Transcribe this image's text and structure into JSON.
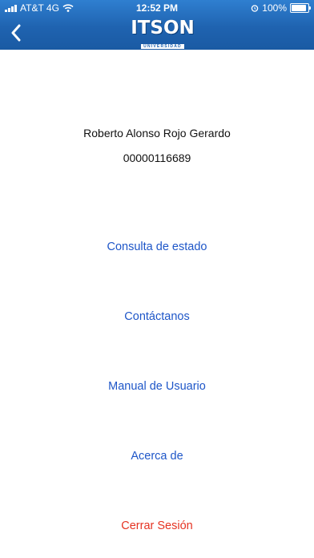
{
  "status_bar": {
    "carrier": "AT&T 4G",
    "time": "12:52 PM",
    "battery": "100%",
    "battery_level": 1.0
  },
  "header": {
    "logo_text": "ITSON",
    "logo_subtext": "UNIVERSIDAD",
    "back_icon": "chevron-left-icon",
    "accent_color": "#1f63b0"
  },
  "user": {
    "name": "Roberto Alonso Rojo Gerardo",
    "id": "00000116689"
  },
  "menu": {
    "items": [
      {
        "label": "Consulta de estado",
        "color": "#1e56c8"
      },
      {
        "label": "Contáctanos",
        "color": "#1e56c8"
      },
      {
        "label": "Manual de Usuario",
        "color": "#1e56c8"
      },
      {
        "label": "Acerca de",
        "color": "#1e56c8"
      },
      {
        "label": "Cerrar Sesión",
        "color": "#e53322"
      }
    ]
  }
}
